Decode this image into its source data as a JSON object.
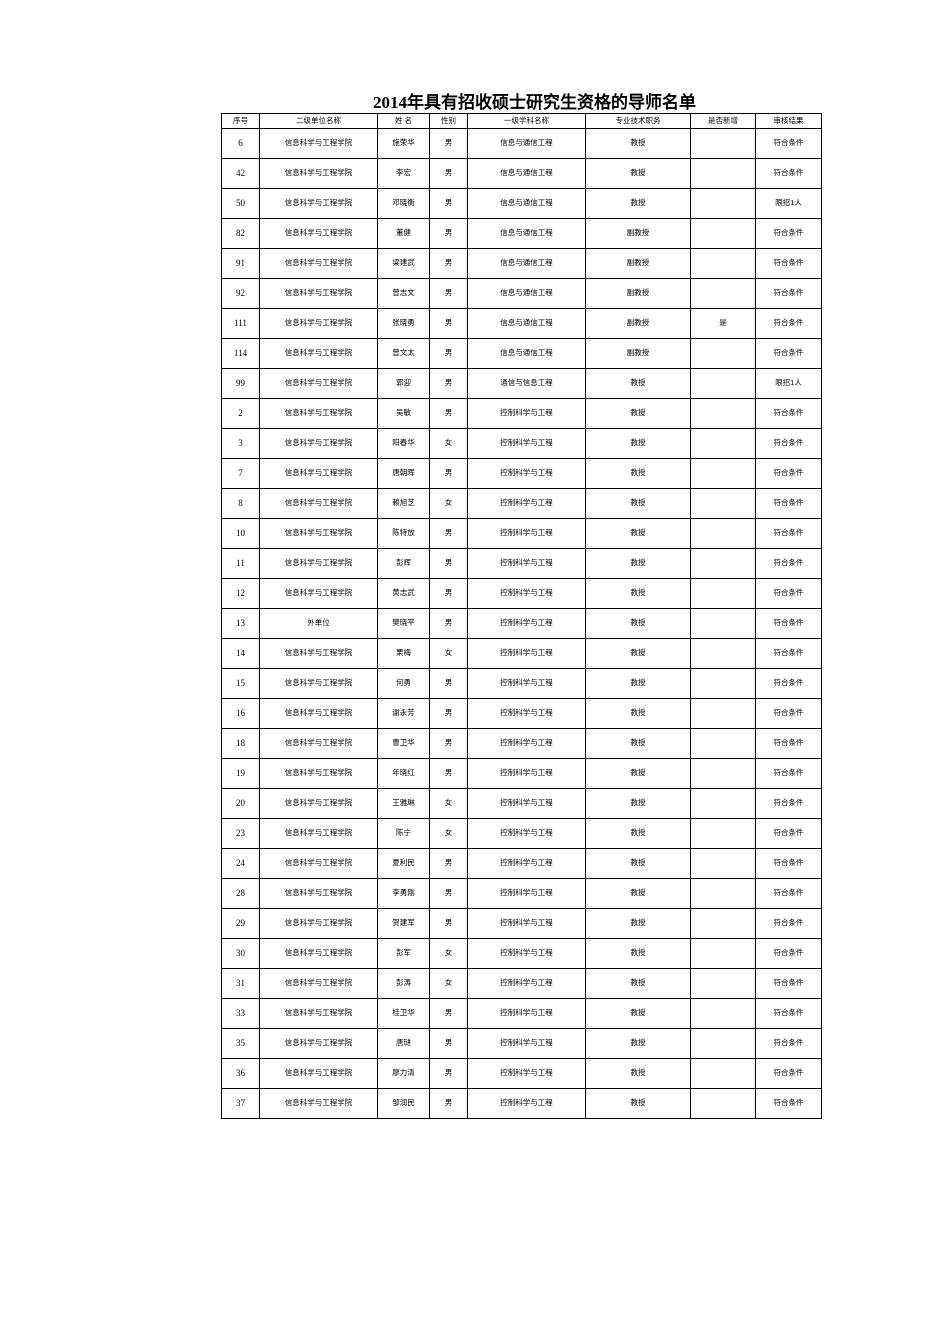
{
  "document": {
    "title": "2014年具有招收硕士研究生资格的导师名单"
  },
  "table": {
    "columns": [
      {
        "key": "no",
        "label": "序号"
      },
      {
        "key": "unit",
        "label": "二级单位名称"
      },
      {
        "key": "name",
        "label": "姓  名"
      },
      {
        "key": "sex",
        "label": "性别"
      },
      {
        "key": "disc",
        "label": "一级学科名称"
      },
      {
        "key": "title",
        "label": "专业技术职务"
      },
      {
        "key": "isnew",
        "label": "是否新增"
      },
      {
        "key": "result",
        "label": "审核结果"
      }
    ],
    "rows": [
      [
        "6",
        "信息科学与工程学院",
        "施荣华",
        "男",
        "信息与通信工程",
        "教授",
        "",
        "符合条件"
      ],
      [
        "42",
        "信息科学与工程学院",
        "李宏",
        "男",
        "信息与通信工程",
        "教授",
        "",
        "符合条件"
      ],
      [
        "50",
        "信息科学与工程学院",
        "邓晓衡",
        "男",
        "信息与通信工程",
        "教授",
        "",
        "限招1人"
      ],
      [
        "82",
        "信息科学与工程学院",
        "董健",
        "男",
        "信息与通信工程",
        "副教授",
        "",
        "符合条件"
      ],
      [
        "91",
        "信息科学与工程学院",
        "梁建武",
        "男",
        "信息与通信工程",
        "副教授",
        "",
        "符合条件"
      ],
      [
        "92",
        "信息科学与工程学院",
        "曾志文",
        "男",
        "信息与通信工程",
        "副教授",
        "",
        "符合条件"
      ],
      [
        "111",
        "信息科学与工程学院",
        "张晓勇",
        "男",
        "信息与通信工程",
        "副教授",
        "是",
        "符合条件"
      ],
      [
        "114",
        "信息科学与工程学院",
        "曾文太",
        "男",
        "信息与通信工程",
        "副教授",
        "",
        "符合条件"
      ],
      [
        "99",
        "信息科学与工程学院",
        "郭迎",
        "男",
        "通信与信息工程",
        "教授",
        "",
        "限招1人"
      ],
      [
        "2",
        "信息科学与工程学院",
        "吴敏",
        "男",
        "控制科学与工程",
        "教授",
        "",
        "符合条件"
      ],
      [
        "3",
        "信息科学与工程学院",
        "阳春华",
        "女",
        "控制科学与工程",
        "教授",
        "",
        "符合条件"
      ],
      [
        "7",
        "信息科学与工程学院",
        "唐朝晖",
        "男",
        "控制科学与工程",
        "教授",
        "",
        "符合条件"
      ],
      [
        "8",
        "信息科学与工程学院",
        "赖旭芝",
        "女",
        "控制科学与工程",
        "教授",
        "",
        "符合条件"
      ],
      [
        "10",
        "信息科学与工程学院",
        "陈特放",
        "男",
        "控制科学与工程",
        "教授",
        "",
        "符合条件"
      ],
      [
        "11",
        "信息科学与工程学院",
        "彭辉",
        "男",
        "控制科学与工程",
        "教授",
        "",
        "符合条件"
      ],
      [
        "12",
        "信息科学与工程学院",
        "黄志武",
        "男",
        "控制科学与工程",
        "教授",
        "",
        "符合条件"
      ],
      [
        "13",
        "外单位",
        "樊晓平",
        "男",
        "控制科学与工程",
        "教授",
        "",
        "符合条件"
      ],
      [
        "14",
        "信息科学与工程学院",
        "栗梅",
        "女",
        "控制科学与工程",
        "教授",
        "",
        "符合条件"
      ],
      [
        "15",
        "信息科学与工程学院",
        "何勇",
        "男",
        "控制科学与工程",
        "教授",
        "",
        "符合条件"
      ],
      [
        "16",
        "信息科学与工程学院",
        "谢永芳",
        "男",
        "控制科学与工程",
        "教授",
        "",
        "符合条件"
      ],
      [
        "18",
        "信息科学与工程学院",
        "曹卫华",
        "男",
        "控制科学与工程",
        "教授",
        "",
        "符合条件"
      ],
      [
        "19",
        "信息科学与工程学院",
        "年晓红",
        "男",
        "控制科学与工程",
        "教授",
        "",
        "符合条件"
      ],
      [
        "20",
        "信息科学与工程学院",
        "王雅琳",
        "女",
        "控制科学与工程",
        "教授",
        "",
        "符合条件"
      ],
      [
        "23",
        "信息科学与工程学院",
        "陈宁",
        "女",
        "控制科学与工程",
        "教授",
        "",
        "符合条件"
      ],
      [
        "24",
        "信息科学与工程学院",
        "夏利民",
        "男",
        "控制科学与工程",
        "教授",
        "",
        "符合条件"
      ],
      [
        "28",
        "信息科学与工程学院",
        "李勇刚",
        "男",
        "控制科学与工程",
        "教授",
        "",
        "符合条件"
      ],
      [
        "29",
        "信息科学与工程学院",
        "贺建军",
        "男",
        "控制科学与工程",
        "教授",
        "",
        "符合条件"
      ],
      [
        "30",
        "信息科学与工程学院",
        "彭军",
        "女",
        "控制科学与工程",
        "教授",
        "",
        "符合条件"
      ],
      [
        "31",
        "信息科学与工程学院",
        "彭涛",
        "女",
        "控制科学与工程",
        "教授",
        "",
        "符合条件"
      ],
      [
        "33",
        "信息科学与工程学院",
        "桂卫华",
        "男",
        "控制科学与工程",
        "教授",
        "",
        "符合条件"
      ],
      [
        "35",
        "信息科学与工程学院",
        "唐琎",
        "男",
        "控制科学与工程",
        "教授",
        "",
        "符合条件"
      ],
      [
        "36",
        "信息科学与工程学院",
        "廖力清",
        "男",
        "控制科学与工程",
        "教授",
        "",
        "符合条件"
      ],
      [
        "37",
        "信息科学与工程学院",
        "邹润民",
        "男",
        "控制科学与工程",
        "教授",
        "",
        "符合条件"
      ]
    ]
  }
}
